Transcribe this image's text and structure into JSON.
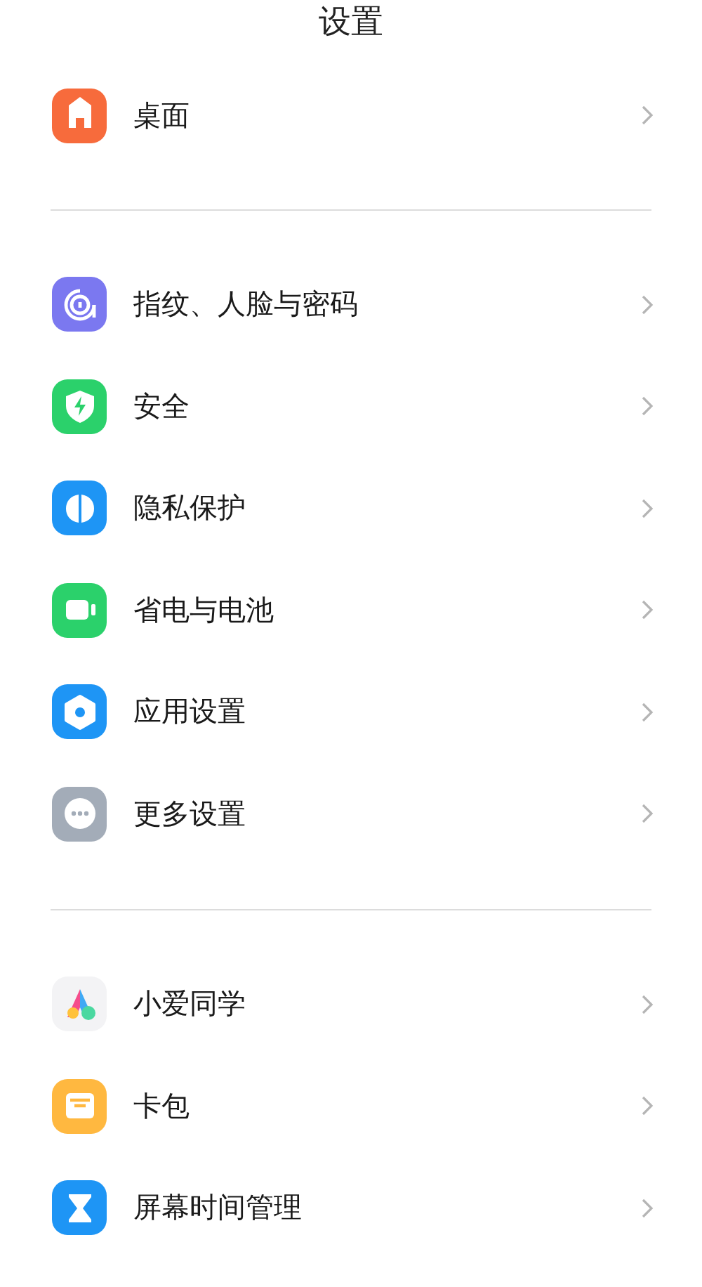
{
  "title": "设置",
  "groups": [
    {
      "items": [
        {
          "label": "桌面",
          "color": "#f76b3c"
        }
      ]
    },
    {
      "items": [
        {
          "label": "指纹、人脸与密码",
          "color": "#7b78f0"
        },
        {
          "label": "安全",
          "color": "#2bd16b"
        },
        {
          "label": "隐私保护",
          "color": "#1e95f5"
        },
        {
          "label": "省电与电池",
          "color": "#2bd16b"
        },
        {
          "label": "应用设置",
          "color": "#1e95f5"
        },
        {
          "label": "更多设置",
          "color": "#a3acb8"
        }
      ]
    },
    {
      "items": [
        {
          "label": "小爱同学",
          "color": "#f3f3f5"
        },
        {
          "label": "卡包",
          "color": "#ffb840"
        },
        {
          "label": "屏幕时间管理",
          "color": "#1e95f5"
        }
      ]
    }
  ]
}
